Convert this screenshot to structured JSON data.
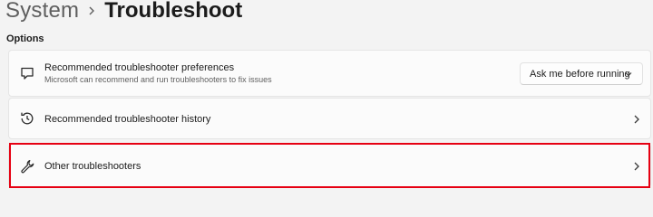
{
  "breadcrumb": {
    "parent": "System",
    "current": "Troubleshoot"
  },
  "section": {
    "label": "Options"
  },
  "rows": [
    {
      "title": "Recommended troubleshooter preferences",
      "subtitle": "Microsoft can recommend and run troubleshooters to fix issues",
      "icon": "chat-bubble-icon",
      "control": {
        "type": "dropdown",
        "selected": "Ask me before running"
      }
    },
    {
      "title": "Recommended troubleshooter history",
      "icon": "history-icon"
    },
    {
      "title": "Other troubleshooters",
      "icon": "wrench-icon",
      "highlighted": true
    }
  ],
  "colors": {
    "highlight": "#e60012",
    "background": "#f3f3f3",
    "card": "#fbfbfb"
  }
}
